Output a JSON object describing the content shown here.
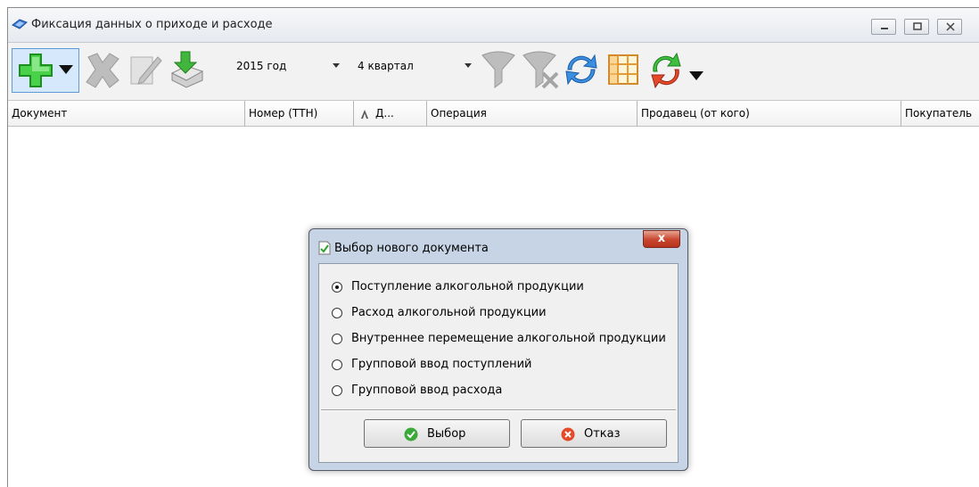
{
  "window": {
    "title": "Фиксация данных о приходе и расходе"
  },
  "toolbar": {
    "year_value": "2015 год",
    "quarter_value": "4 квартал"
  },
  "grid": {
    "columns": [
      "Документ",
      "Номер (ТТН)",
      "Д...",
      "Операция",
      "Продавец (от кого)",
      "Покупатель"
    ]
  },
  "dialog": {
    "title": "Выбор нового документа",
    "close_label": "x",
    "options": [
      {
        "label": "Поступление алкогольной продукции",
        "selected": true
      },
      {
        "label": "Расход алкогольной продукции",
        "selected": false
      },
      {
        "label": "Внутреннее перемещение алкогольной продукции",
        "selected": false
      },
      {
        "label": "Групповой ввод поступлений",
        "selected": false
      },
      {
        "label": "Групповой ввод расхода",
        "selected": false
      }
    ],
    "ok_label": "Выбор",
    "cancel_label": "Отказ"
  },
  "colors": {
    "dialog_frame": "#c6d4e5",
    "close_button": "#c8452e",
    "add_icon": "#3cc43c"
  }
}
